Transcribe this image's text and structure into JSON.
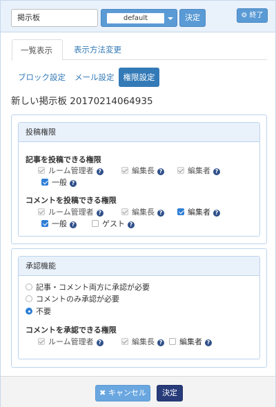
{
  "topbar": {
    "title_input_value": "掲示板",
    "frame_select_value": "default",
    "decide_label": "決定",
    "end_icon": "gear-icon",
    "end_label": "終了"
  },
  "tabs": [
    {
      "label": "一覧表示",
      "active": true
    },
    {
      "label": "表示方法変更",
      "active": false
    }
  ],
  "pills": [
    {
      "label": "ブロック設定",
      "active": false
    },
    {
      "label": "メール設定",
      "active": false
    },
    {
      "label": "権限設定",
      "active": true
    }
  ],
  "block_title": "新しい掲示板 20170214064935",
  "post_permission": {
    "heading": "投稿権限",
    "article": {
      "label": "記事を投稿できる権限",
      "options": [
        {
          "label": "ルーム管理者",
          "state": "checked-disabled"
        },
        {
          "label": "編集長",
          "state": "checked-disabled"
        },
        {
          "label": "編集者",
          "state": "checked-disabled"
        },
        {
          "label": "一般",
          "state": "checked"
        }
      ]
    },
    "comment": {
      "label": "コメントを投稿できる権限",
      "options": [
        {
          "label": "ルーム管理者",
          "state": "checked-disabled"
        },
        {
          "label": "編集長",
          "state": "checked-disabled"
        },
        {
          "label": "編集者",
          "state": "checked"
        },
        {
          "label": "一般",
          "state": "checked"
        },
        {
          "label": "ゲスト",
          "state": "unchecked"
        }
      ]
    }
  },
  "approval": {
    "heading": "承認機能",
    "radios": [
      {
        "label": "記事・コメント両方に承認が必要",
        "selected": false
      },
      {
        "label": "コメントのみ承認が必要",
        "selected": false
      },
      {
        "label": "不要",
        "selected": true
      }
    ],
    "comment_approval": {
      "label": "コメントを承認できる権限",
      "options": [
        {
          "label": "ルーム管理者",
          "state": "checked-disabled"
        },
        {
          "label": "編集長",
          "state": "checked-disabled"
        },
        {
          "label": "編集者",
          "state": "unchecked"
        }
      ]
    }
  },
  "footer": {
    "cancel_icon": "close-icon",
    "cancel_label": "キャンセル",
    "ok_label": "決定"
  },
  "colors": {
    "primary": "#337ab7",
    "button_blue": "#5b9bd5",
    "panel_border": "#bcd3ec",
    "panel_head": "#e9f1fb",
    "ok_button": "#283c7a",
    "help_icon": "#2e4f8a"
  }
}
